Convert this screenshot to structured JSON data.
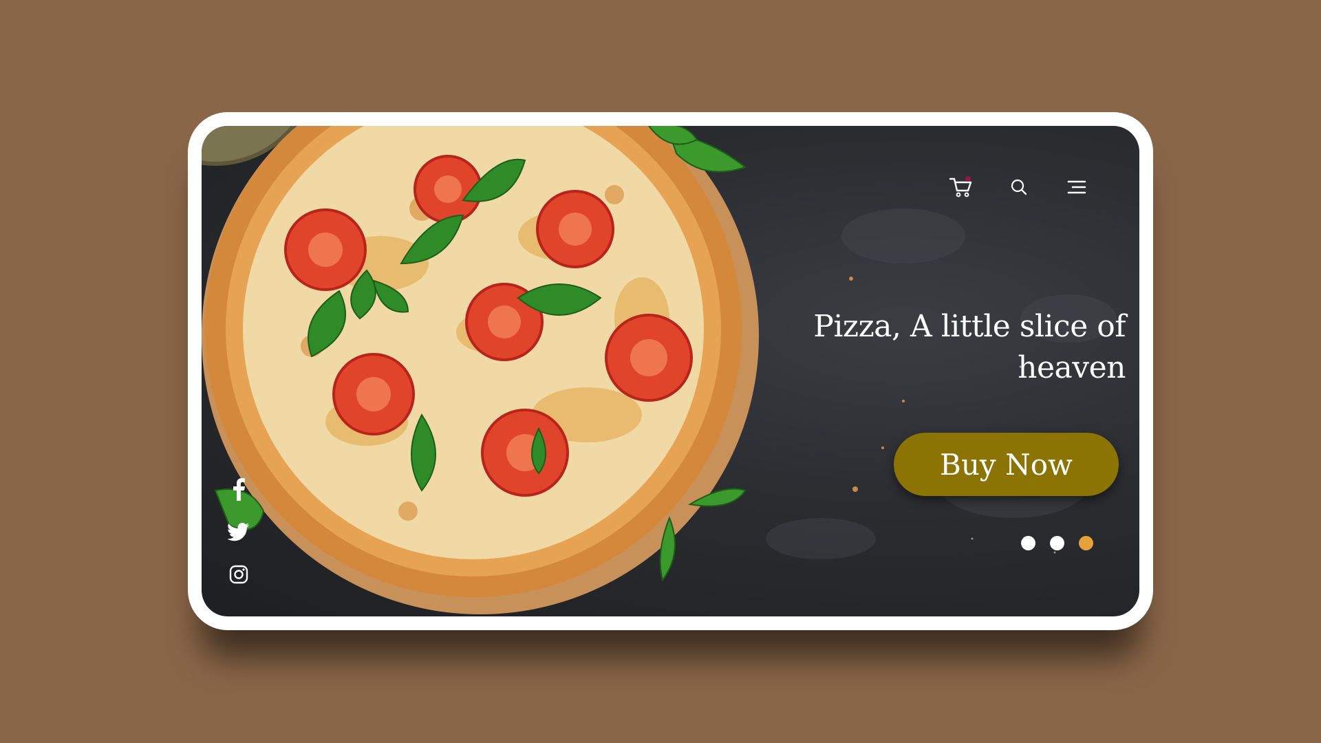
{
  "hero": {
    "headline_line1": "Pizza, A little slice of",
    "headline_line2": "heaven",
    "cta_label": "Buy Now"
  },
  "nav": {
    "icons": [
      "cart-icon",
      "search-icon",
      "menu-icon"
    ],
    "cart_has_badge": true
  },
  "social": {
    "icons": [
      "facebook-icon",
      "twitter-icon",
      "instagram-icon"
    ]
  },
  "carousel": {
    "total_slides": 3,
    "active_index": 2
  },
  "colors": {
    "page_background": "#8a6648",
    "cta_background": "#8b7304",
    "active_dot": "#e8a13a",
    "inactive_dot": "#ffffff",
    "cart_badge": "#8e1a4a",
    "text": "#ffffff"
  }
}
